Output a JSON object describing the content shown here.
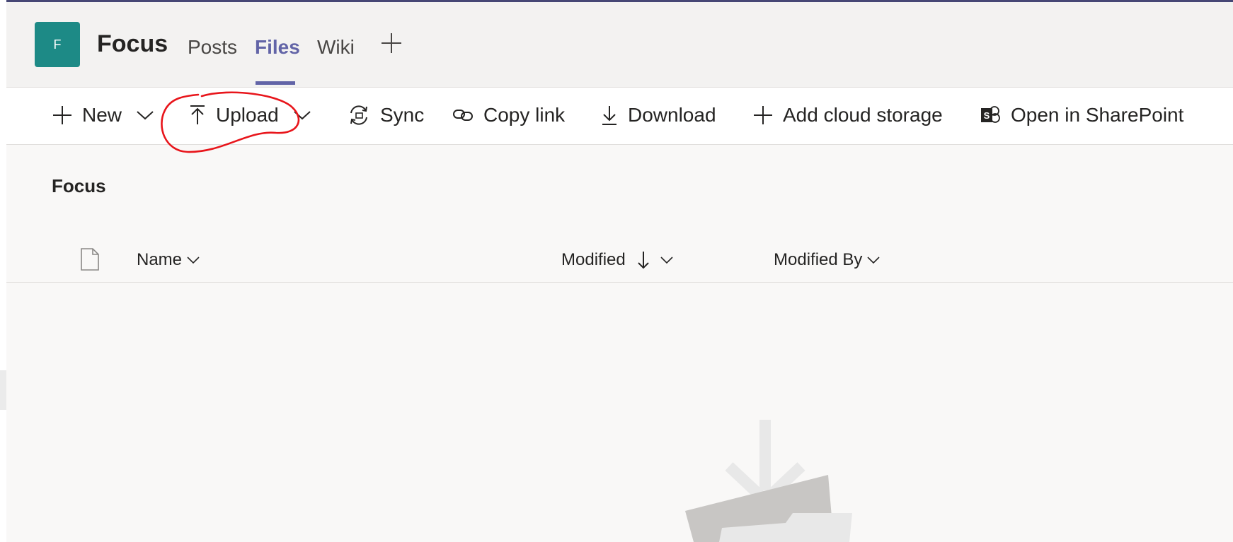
{
  "header": {
    "avatar_initial": "F",
    "team_name": "Focus",
    "tabs": [
      {
        "label": "Posts"
      },
      {
        "label": "Files"
      },
      {
        "label": "Wiki"
      }
    ]
  },
  "toolbar": {
    "new_label": "New",
    "upload_label": "Upload",
    "sync_label": "Sync",
    "copy_link_label": "Copy link",
    "download_label": "Download",
    "add_cloud_label": "Add cloud storage",
    "sharepoint_label": "Open in SharePoint"
  },
  "library": {
    "title": "Focus",
    "columns": {
      "name": "Name",
      "modified": "Modified",
      "modified_by": "Modified By"
    }
  },
  "colors": {
    "accent": "#6264a7",
    "avatar_bg": "#1d8a86",
    "annotation": "#e8151b"
  },
  "icons": [
    "add-icon",
    "chevron-down-icon",
    "upload-icon",
    "sync-icon",
    "link-icon",
    "download-icon",
    "sharepoint-icon",
    "file-icon",
    "sort-down-arrow-icon"
  ]
}
